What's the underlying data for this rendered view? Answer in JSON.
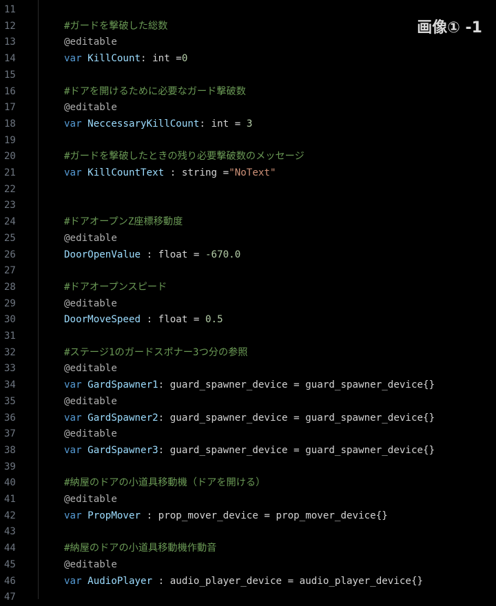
{
  "badge": "画像① -1",
  "colors": {
    "background": "#000000",
    "line_number": "#6e7681",
    "comment": "#6a9955",
    "keyword": "#569cd6",
    "identifier": "#9cdcfe",
    "string": "#ce9178",
    "number": "#b5cea8"
  },
  "lines": [
    {
      "no": "11",
      "tokens": []
    },
    {
      "no": "12",
      "tokens": [
        {
          "t": "#ガードを撃破した総数",
          "c": "comment"
        }
      ]
    },
    {
      "no": "13",
      "tokens": [
        {
          "t": "@editable",
          "c": "attr"
        }
      ]
    },
    {
      "no": "14",
      "tokens": [
        {
          "t": "var ",
          "c": "kw"
        },
        {
          "t": "KillCount",
          "c": "var"
        },
        {
          "t": ": int =",
          "c": "plain"
        },
        {
          "t": "0",
          "c": "num"
        }
      ]
    },
    {
      "no": "15",
      "tokens": []
    },
    {
      "no": "16",
      "tokens": [
        {
          "t": "#ドアを開けるために必要なガード撃破数",
          "c": "comment"
        }
      ]
    },
    {
      "no": "17",
      "tokens": [
        {
          "t": "@editable",
          "c": "attr"
        }
      ]
    },
    {
      "no": "18",
      "tokens": [
        {
          "t": "var ",
          "c": "kw"
        },
        {
          "t": "NeccessaryKillCount",
          "c": "var"
        },
        {
          "t": ": int = ",
          "c": "plain"
        },
        {
          "t": "3",
          "c": "num"
        }
      ]
    },
    {
      "no": "19",
      "tokens": []
    },
    {
      "no": "20",
      "tokens": [
        {
          "t": "#ガードを撃破したときの残り必要撃破数のメッセージ",
          "c": "comment"
        }
      ]
    },
    {
      "no": "21",
      "tokens": [
        {
          "t": "var ",
          "c": "kw"
        },
        {
          "t": "KillCountText",
          "c": "var"
        },
        {
          "t": " : string =",
          "c": "plain"
        },
        {
          "t": "\"NoText\"",
          "c": "str"
        }
      ]
    },
    {
      "no": "22",
      "tokens": []
    },
    {
      "no": "23",
      "tokens": []
    },
    {
      "no": "24",
      "tokens": [
        {
          "t": "#ドアオープンZ座標移動度",
          "c": "comment"
        }
      ]
    },
    {
      "no": "25",
      "tokens": [
        {
          "t": "@editable",
          "c": "attr"
        }
      ]
    },
    {
      "no": "26",
      "tokens": [
        {
          "t": "DoorOpenValue",
          "c": "var"
        },
        {
          "t": " : float = ",
          "c": "plain"
        },
        {
          "t": "-670.0",
          "c": "num"
        }
      ]
    },
    {
      "no": "27",
      "tokens": []
    },
    {
      "no": "28",
      "tokens": [
        {
          "t": "#ドアオープンスピード",
          "c": "comment"
        }
      ]
    },
    {
      "no": "29",
      "tokens": [
        {
          "t": "@editable",
          "c": "attr"
        }
      ]
    },
    {
      "no": "30",
      "tokens": [
        {
          "t": "DoorMoveSpeed",
          "c": "var"
        },
        {
          "t": " : float = ",
          "c": "plain"
        },
        {
          "t": "0.5",
          "c": "num"
        }
      ]
    },
    {
      "no": "31",
      "tokens": []
    },
    {
      "no": "32",
      "tokens": [
        {
          "t": "#ステージ1のガードスポナー3つ分の参照",
          "c": "comment"
        }
      ]
    },
    {
      "no": "33",
      "tokens": [
        {
          "t": "@editable",
          "c": "attr"
        }
      ]
    },
    {
      "no": "34",
      "tokens": [
        {
          "t": "var ",
          "c": "kw"
        },
        {
          "t": "GardSpawner1",
          "c": "var"
        },
        {
          "t": ": guard_spawner_device = guard_spawner_device{}",
          "c": "plain"
        }
      ]
    },
    {
      "no": "35",
      "tokens": [
        {
          "t": "@editable",
          "c": "attr"
        }
      ]
    },
    {
      "no": "36",
      "tokens": [
        {
          "t": "var ",
          "c": "kw"
        },
        {
          "t": "GardSpawner2",
          "c": "var"
        },
        {
          "t": ": guard_spawner_device = guard_spawner_device{}",
          "c": "plain"
        }
      ]
    },
    {
      "no": "37",
      "tokens": [
        {
          "t": "@editable",
          "c": "attr"
        }
      ]
    },
    {
      "no": "38",
      "tokens": [
        {
          "t": "var ",
          "c": "kw"
        },
        {
          "t": "GardSpawner3",
          "c": "var"
        },
        {
          "t": ": guard_spawner_device = guard_spawner_device{}",
          "c": "plain"
        }
      ]
    },
    {
      "no": "39",
      "tokens": []
    },
    {
      "no": "40",
      "tokens": [
        {
          "t": "#納屋のドアの小道具移動機（ドアを開ける）",
          "c": "comment"
        }
      ]
    },
    {
      "no": "41",
      "tokens": [
        {
          "t": "@editable",
          "c": "attr"
        }
      ]
    },
    {
      "no": "42",
      "tokens": [
        {
          "t": "var ",
          "c": "kw"
        },
        {
          "t": "PropMover",
          "c": "var"
        },
        {
          "t": " : prop_mover_device = prop_mover_device{}",
          "c": "plain"
        }
      ]
    },
    {
      "no": "43",
      "tokens": []
    },
    {
      "no": "44",
      "tokens": [
        {
          "t": "#納屋のドアの小道具移動機作動音",
          "c": "comment"
        }
      ]
    },
    {
      "no": "45",
      "tokens": [
        {
          "t": "@editable",
          "c": "attr"
        }
      ]
    },
    {
      "no": "46",
      "tokens": [
        {
          "t": "var ",
          "c": "kw"
        },
        {
          "t": "AudioPlayer",
          "c": "var"
        },
        {
          "t": " : audio_player_device = audio_player_device{}",
          "c": "plain"
        }
      ]
    },
    {
      "no": "47",
      "tokens": []
    }
  ]
}
